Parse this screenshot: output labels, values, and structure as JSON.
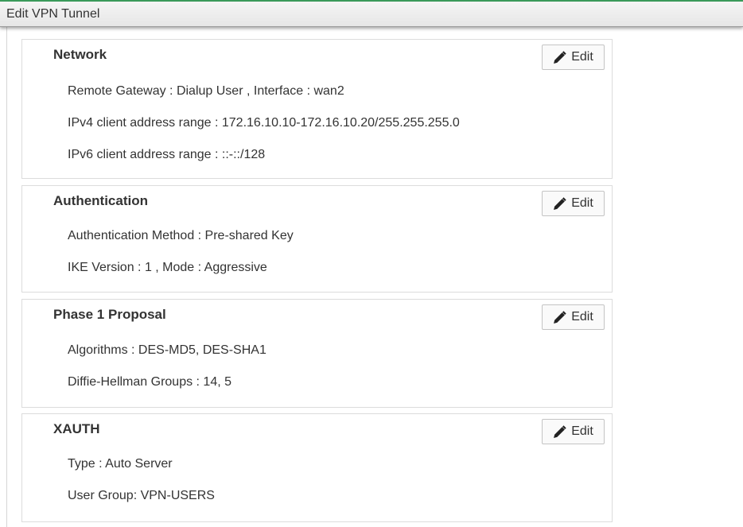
{
  "window": {
    "title": "Edit VPN Tunnel"
  },
  "sections": [
    {
      "title": "Network",
      "edit_label": "Edit",
      "rows": [
        "Remote Gateway : Dialup User , Interface : wan2",
        "IPv4 client address range : 172.16.10.10-172.16.10.20/255.255.255.0",
        "IPv6 client address range : ::-::/128"
      ]
    },
    {
      "title": "Authentication",
      "edit_label": "Edit",
      "rows": [
        "Authentication Method : Pre-shared Key",
        "IKE Version : 1 , Mode : Aggressive"
      ]
    },
    {
      "title": "Phase 1 Proposal",
      "edit_label": "Edit",
      "rows": [
        "Algorithms : DES-MD5, DES-SHA1",
        "Diffie-Hellman Groups : 14, 5"
      ]
    },
    {
      "title": "XAUTH",
      "edit_label": "Edit",
      "rows": [
        "Type : Auto Server",
        "User Group: VPN-USERS"
      ]
    }
  ],
  "icons": {
    "edit": "pencil-icon"
  },
  "colors": {
    "titlebar_accent": "#3a9a5a"
  }
}
